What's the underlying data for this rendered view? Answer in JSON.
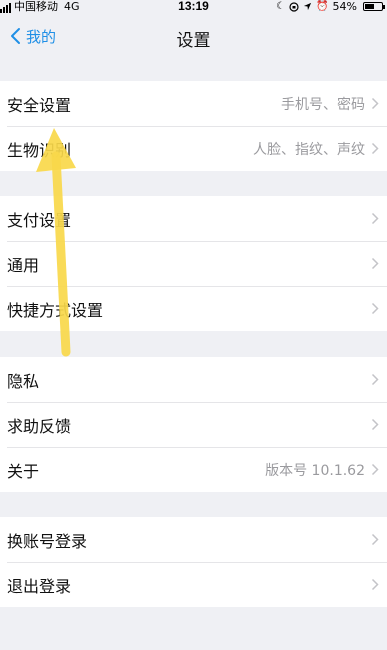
{
  "status_bar": {
    "carrier": "中国移动",
    "network": "4G",
    "time": "13:19",
    "battery_percent": "54%",
    "battery_level": 0.54,
    "icons": [
      "moon-icon",
      "rotation-lock-icon",
      "location-icon",
      "alarm-icon"
    ]
  },
  "nav": {
    "back_label": "我的",
    "title": "设置"
  },
  "groups": [
    {
      "items": [
        {
          "label": "安全设置",
          "value": "手机号、密码"
        },
        {
          "label": "生物识别",
          "value": "人脸、指纹、声纹"
        }
      ]
    },
    {
      "items": [
        {
          "label": "支付设置",
          "value": ""
        },
        {
          "label": "通用",
          "value": ""
        },
        {
          "label": "快捷方式设置",
          "value": ""
        }
      ]
    },
    {
      "items": [
        {
          "label": "隐私",
          "value": ""
        },
        {
          "label": "求助反馈",
          "value": ""
        },
        {
          "label": "关于",
          "value": "版本号 10.1.62"
        }
      ]
    },
    {
      "items": [
        {
          "label": "换账号登录",
          "value": ""
        },
        {
          "label": "退出登录",
          "value": ""
        }
      ]
    }
  ],
  "colors": {
    "accent": "#1f8fe6",
    "background": "#eff0f4",
    "annotation_arrow": "#f9d84a"
  }
}
